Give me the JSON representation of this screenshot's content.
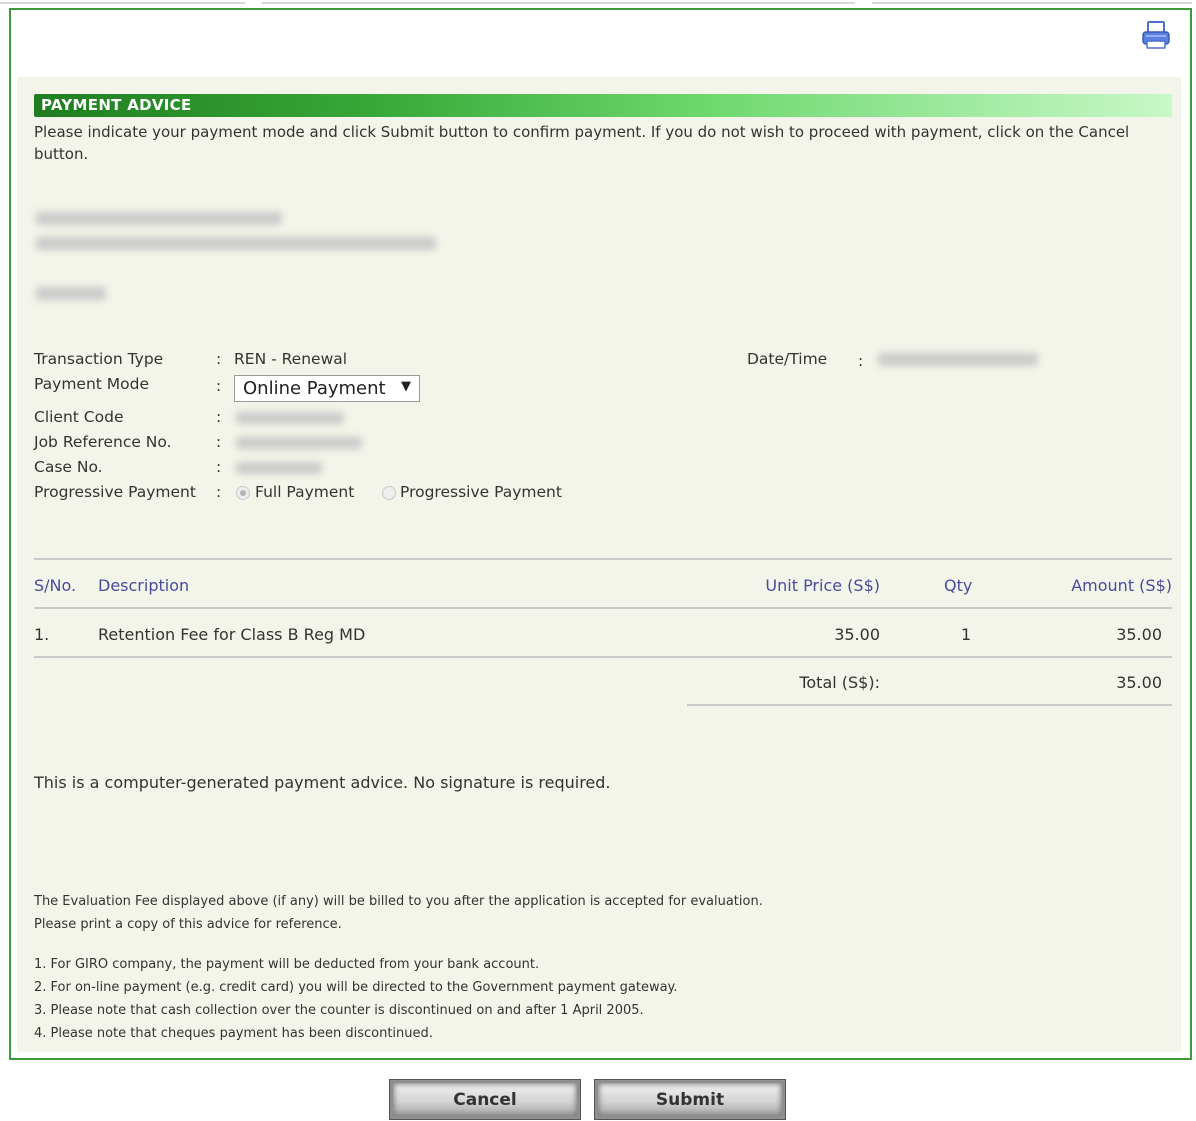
{
  "advice": {
    "title": "PAYMENT ADVICE",
    "intro": "Please indicate your payment mode and click Submit button to confirm payment. If you do not wish to proceed with payment, click on the Cancel button."
  },
  "icons": {
    "print": "printer-icon"
  },
  "fields": {
    "transaction_type_label": "Transaction Type",
    "transaction_type_value": "REN - Renewal",
    "payment_mode_label": "Payment Mode",
    "payment_mode_value": "Online Payment",
    "client_code_label": "Client Code",
    "job_ref_label": "Job Reference No.",
    "case_no_label": "Case No.",
    "progressive_label": "Progressive Payment",
    "option_full": "Full Payment",
    "option_progressive": "Progressive Payment",
    "datetime_label": "Date/Time",
    "colon": ":"
  },
  "table": {
    "headers": {
      "sno": "S/No.",
      "description": "Description",
      "unit_price": "Unit Price (S$)",
      "qty": "Qty",
      "amount": "Amount (S$)"
    },
    "rows": [
      {
        "sno": "1.",
        "description": "Retention Fee for Class B Reg MD",
        "unit_price": "35.00",
        "qty": "1",
        "amount": "35.00"
      }
    ],
    "total_label": "Total (S$):",
    "total_value": "35.00"
  },
  "notes": {
    "computer_generated": "This is a computer-generated payment advice. No signature is required.",
    "evaluation_fee": "The Evaluation Fee displayed above (if any) will be billed to you after the application is accepted for evaluation.",
    "print_copy": "Please print a copy of this advice for reference.",
    "list": [
      "1. For GIRO company, the payment will be deducted from your bank account.",
      "2. For on-line payment (e.g. credit card) you will be directed to the Government payment gateway.",
      "3. Please note that cash collection over the counter is discontinued on and after 1 April 2005.",
      "4. Please note that cheques payment has been discontinued."
    ]
  },
  "buttons": {
    "cancel": "Cancel",
    "submit": "Submit"
  },
  "colors": {
    "border": "#3c9a3c",
    "panel": "#f4f5ea",
    "header_start": "#1f7d1f",
    "header_end": "#c8f8c8",
    "table_header_text": "#4a4a9a"
  }
}
